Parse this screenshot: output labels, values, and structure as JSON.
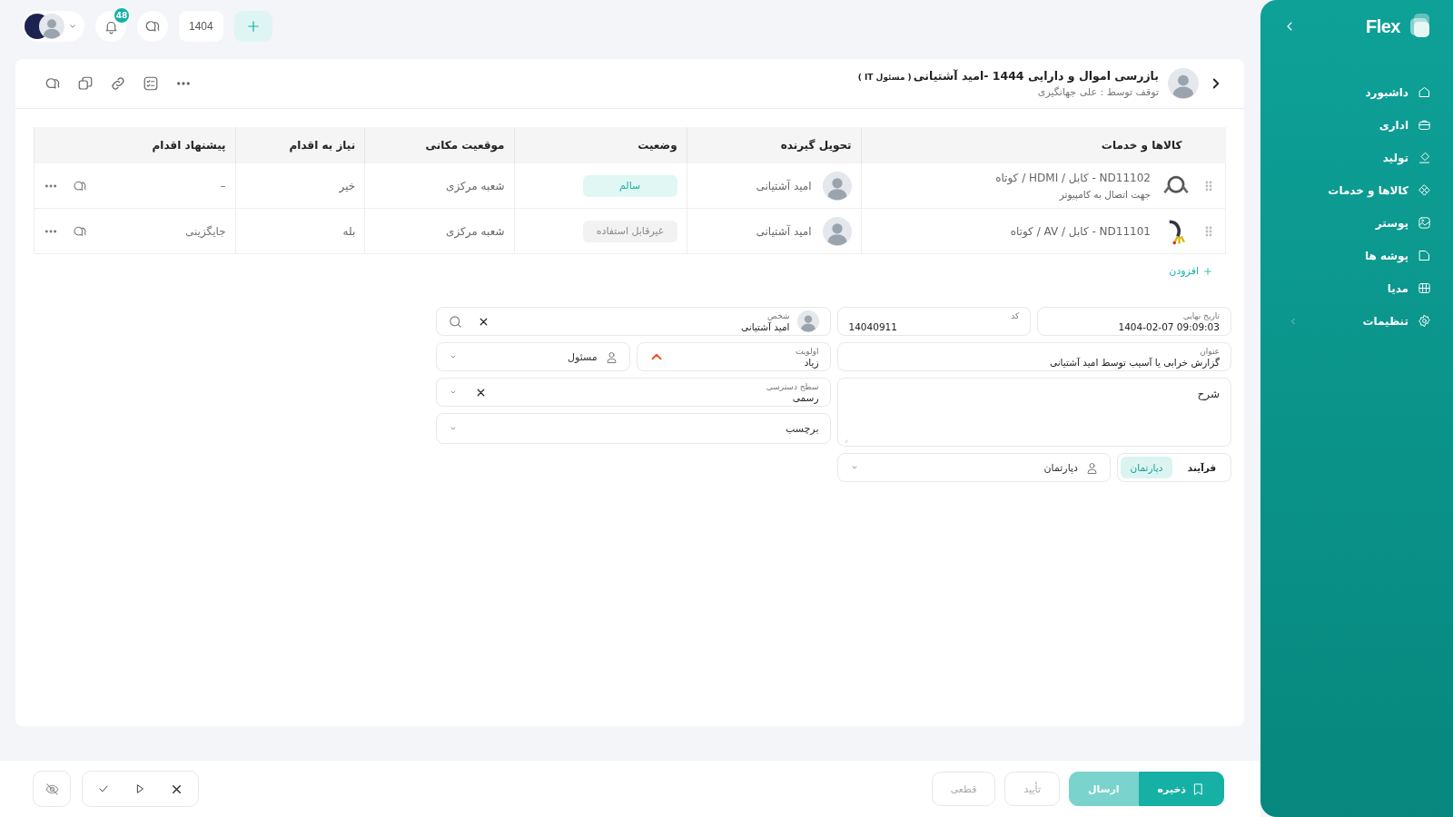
{
  "sidebar": {
    "logo": "Flex",
    "items": [
      {
        "label": "داشبورد",
        "kind": "link"
      },
      {
        "label": "اداری",
        "kind": "link"
      },
      {
        "label": "تولید",
        "kind": "link"
      },
      {
        "label": "کالاها و خدمات",
        "kind": "link"
      },
      {
        "label": "پوستر",
        "kind": "link"
      },
      {
        "label": "پوشه ها",
        "kind": "link"
      },
      {
        "label": "مدیا",
        "kind": "link"
      },
      {
        "label": "تنظیمات",
        "kind": "group"
      }
    ]
  },
  "topbar": {
    "notification_count": "48",
    "year": "1404"
  },
  "task": {
    "title": "بازرسی اموال و دارایی 1444 -امید آشتیانی",
    "title_note": "( مسئول IT )",
    "subtitle": "توقف توسط : علی جهانگیری"
  },
  "table": {
    "columns": [
      "کالاها و خدمات",
      "تحویل گیرنده",
      "وضعیت",
      "موقعیت مکانی",
      "نیاز به اقدام",
      "پیشنهاد اقدام"
    ],
    "rows": [
      {
        "item": "ND11102 - کابل / HDMI / کوتاه",
        "note": "جهت اتصال به کامپیوتر",
        "recipient": "امید آشتیانی",
        "status": {
          "label": "سالم",
          "kind": "ok"
        },
        "location": "شعبه مرکزی",
        "needs_action": "خیر",
        "suggestion": "–"
      },
      {
        "item": "ND11101 - کابل / AV / کوتاه",
        "recipient": "امید آشتیانی",
        "status": {
          "label": "غیرقابل استفاده",
          "kind": "unusable"
        },
        "location": "شعبه مرکزی",
        "needs_action": "بله",
        "suggestion": "جایگزینی"
      }
    ]
  },
  "add_label": "افزودن",
  "form": {
    "deadline": {
      "label": "تاریخ نهایی",
      "value": "1404-02-07 09:09:03"
    },
    "code": {
      "label": "کد",
      "value": "14040911"
    },
    "person": {
      "label": "شخص",
      "value": "امید آشتیانی"
    },
    "title": {
      "label": "عنوان",
      "value": "گزارش خرابی یا آسیب توسط امید آشتیانی"
    },
    "priority": {
      "label": "اولویت",
      "value": "زیاد",
      "kind": "high"
    },
    "responsible": {
      "placeholder": "مسئول"
    },
    "access": {
      "label": "سطح دسترسی",
      "value": "رسمی"
    },
    "description": {
      "placeholder": "شرح"
    },
    "tag": {
      "placeholder": "برچسب"
    },
    "assign_modes": [
      {
        "label": "فرآیند",
        "selected": false
      },
      {
        "label": "دپارتمان",
        "selected": true
      }
    ],
    "department": {
      "placeholder": "دپارتمان"
    }
  },
  "actions": {
    "buttons": [
      {
        "label": "ذخیره",
        "kind": "primary",
        "disabled": false
      },
      {
        "label": "ارسال",
        "kind": "secondary",
        "disabled": false
      },
      {
        "label": "تأیید",
        "kind": "plain",
        "disabled": true
      },
      {
        "label": "قطعی",
        "kind": "plain",
        "disabled": true
      }
    ]
  }
}
